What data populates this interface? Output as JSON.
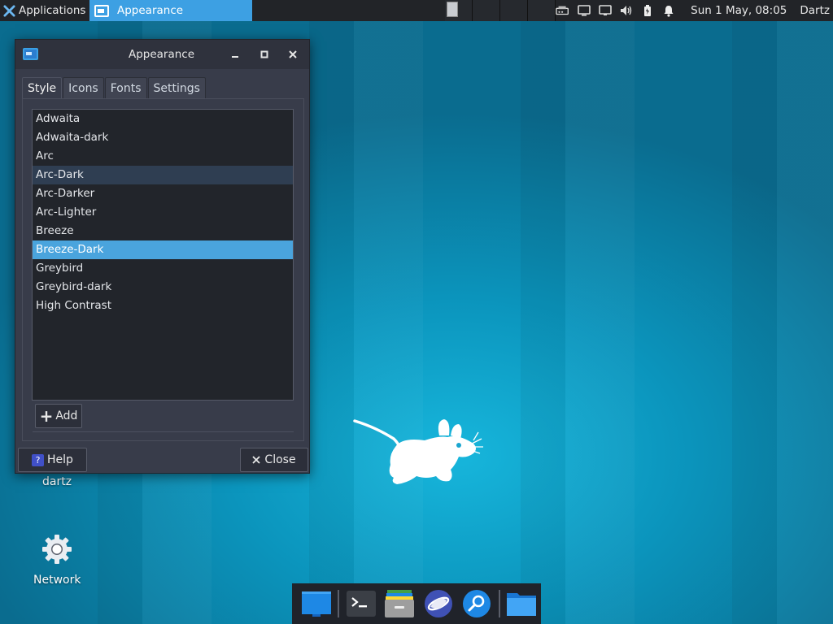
{
  "top_panel": {
    "apps_label": "Applications",
    "apps_separator": "⠿",
    "taskbar_window_title": "Appearance",
    "clock": "Sun  1 May, 08:05",
    "user": "Dartz"
  },
  "window": {
    "title": "Appearance",
    "tabs": [
      {
        "label": "Style",
        "active": true
      },
      {
        "label": "Icons",
        "active": false
      },
      {
        "label": "Fonts",
        "active": false
      },
      {
        "label": "Settings",
        "active": false
      }
    ],
    "themes": [
      {
        "name": "Adwaita",
        "state": ""
      },
      {
        "name": "Adwaita-dark",
        "state": ""
      },
      {
        "name": "Arc",
        "state": ""
      },
      {
        "name": "Arc-Dark",
        "state": "hover"
      },
      {
        "name": "Arc-Darker",
        "state": ""
      },
      {
        "name": "Arc-Lighter",
        "state": ""
      },
      {
        "name": "Breeze",
        "state": ""
      },
      {
        "name": "Breeze-Dark",
        "state": "selected"
      },
      {
        "name": "Greybird",
        "state": ""
      },
      {
        "name": "Greybird-dark",
        "state": ""
      },
      {
        "name": "High Contrast",
        "state": ""
      }
    ],
    "add_label": "Add",
    "help_label": "Help",
    "close_label": "Close"
  },
  "desktop": {
    "home_label": "dartz",
    "network_label": "Network"
  },
  "dock": {
    "items": [
      "show-desktop-icon",
      "terminal-icon",
      "file-manager-icon",
      "web-browser-icon",
      "app-finder-icon",
      "folder-icon"
    ]
  },
  "colors": {
    "accent": "#4aa4dd",
    "panel": "#222428",
    "window_bg": "#383c4a",
    "list_bg": "#22252b"
  }
}
